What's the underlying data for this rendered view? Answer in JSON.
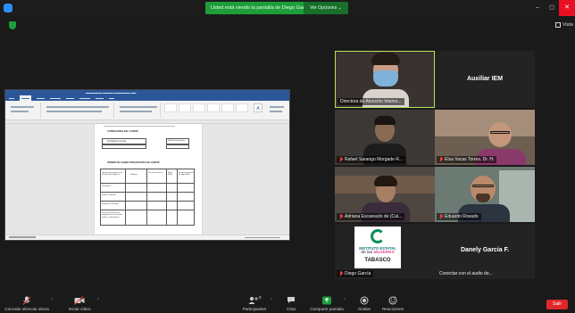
{
  "titlebar": {
    "share_banner": "Usted está viendo la pantalla de Diego Garcia",
    "view_options": "Ver Opciones ⌄"
  },
  "top": {
    "view_label": "Vista"
  },
  "participants": [
    {
      "name": "Directora de Atención Interior..."
    },
    {
      "name": "Auxiliar IEM"
    },
    {
      "name": "Rafael Sarango Morgade R..."
    },
    {
      "name": "Elsa Vacas Torres. Dr. H."
    },
    {
      "name": "Adriana Escareado de (Cal..."
    },
    {
      "name": "Eduardo Rosado"
    },
    {
      "name": "Diego García"
    },
    {
      "name": "Danely García F."
    },
    {
      "name": "Conectar con el audio de..."
    }
  ],
  "logo": {
    "line1": "INSTITUTO ESTATAL",
    "line2a": "de las",
    "line2b": "MUJERES",
    "line3": "TABASCO"
  },
  "toolbar": {
    "mute": "Cancelar silenciar ahora",
    "video": "Iniciar vídeo",
    "participants": "Participantes",
    "participants_count": "9",
    "chat": "Chat",
    "share": "Compartir pantalla",
    "record": "Grabar",
    "reactions": "Reacciones",
    "leave": "Salir"
  },
  "doc": {
    "heading": "CONDICIONES DEL COMITÉ",
    "col_left": "Presidente Comité",
    "col_right": "Entidad Contratante",
    "section": "PRIMER DE SABER INTEGRANTES DE COMITÉ",
    "th1": "Tipo de representación en el Comité de Vigilancia",
    "th2": "Nombre",
    "th3": "Correo electrónico",
    "th4": "Sexo (M/H)",
    "th5": "Firma compromiso de adquisición",
    "r1": "Presidente",
    "r2": "Primer Contralor",
    "r3": "Segundo Contralor",
    "r4": "Persona al frente de la organización o el servidor público y subordinado"
  },
  "colors": {
    "accent_green": "#1e9e3a",
    "active_border": "#b7e35b",
    "leave_red": "#e02828",
    "muted_red": "#ff3b3b"
  }
}
